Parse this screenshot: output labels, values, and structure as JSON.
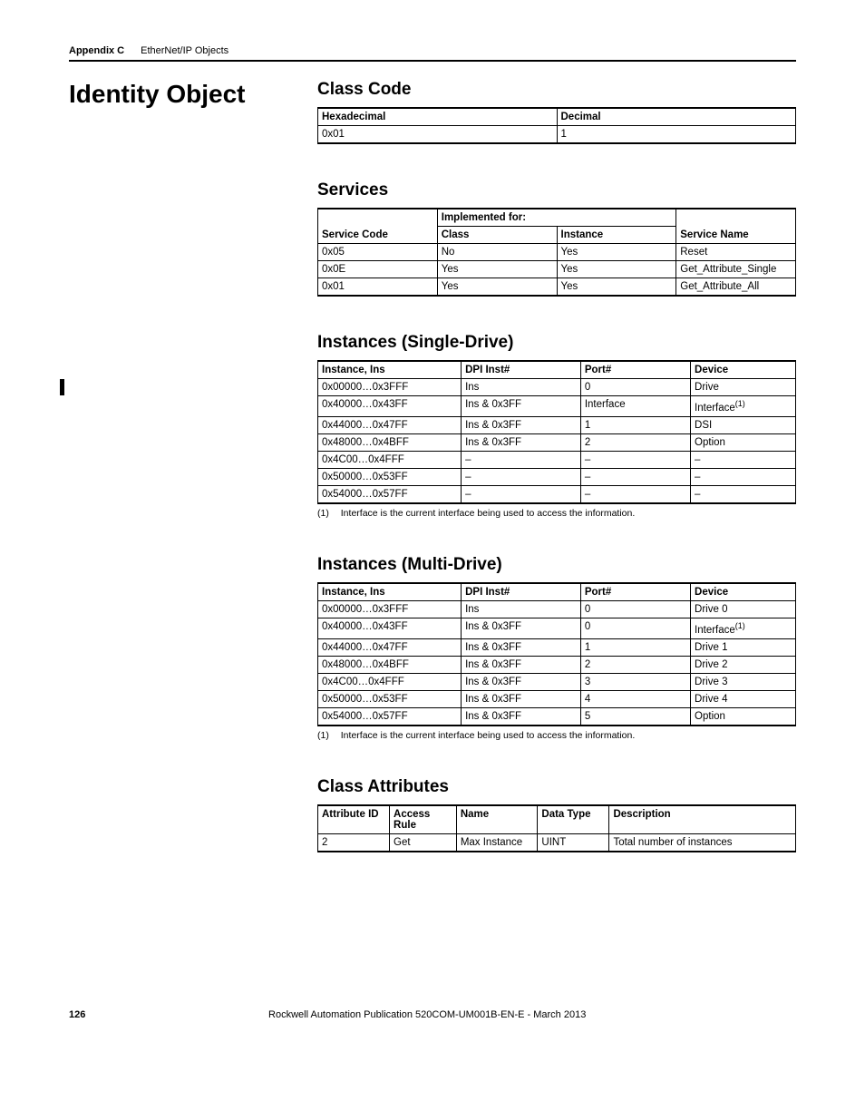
{
  "header": {
    "appendix": "Appendix C",
    "title": "EtherNet/IP Objects"
  },
  "mainHeading": "Identity Object",
  "sections": {
    "classCode": {
      "heading": "Class Code",
      "headers": [
        "Hexadecimal",
        "Decimal"
      ],
      "rows": [
        [
          "0x01",
          "1"
        ]
      ]
    },
    "services": {
      "heading": "Services",
      "groupHeader": "Implemented for:",
      "headers": [
        "Service Code",
        "Class",
        "Instance",
        "Service Name"
      ],
      "rows": [
        [
          "0x05",
          "No",
          "Yes",
          "Reset"
        ],
        [
          "0x0E",
          "Yes",
          "Yes",
          "Get_Attribute_Single"
        ],
        [
          "0x01",
          "Yes",
          "Yes",
          "Get_Attribute_All"
        ]
      ]
    },
    "instancesSingle": {
      "heading": "Instances (Single-Drive)",
      "headers": [
        "Instance, Ins",
        "DPI Inst#",
        "Port#",
        "Device"
      ],
      "rows": [
        {
          "cells": [
            "0x00000…0x3FFF",
            "Ins",
            "0",
            "Drive"
          ],
          "sup": false
        },
        {
          "cells": [
            "0x40000…0x43FF",
            "Ins & 0x3FF",
            "Interface",
            "Interface"
          ],
          "sup": true
        },
        {
          "cells": [
            "0x44000…0x47FF",
            "Ins & 0x3FF",
            "1",
            "DSI"
          ],
          "sup": false
        },
        {
          "cells": [
            "0x48000…0x4BFF",
            "Ins & 0x3FF",
            "2",
            "Option"
          ],
          "sup": false
        },
        {
          "cells": [
            "0x4C00…0x4FFF",
            "–",
            "–",
            "–"
          ],
          "sup": false
        },
        {
          "cells": [
            "0x50000…0x53FF",
            "–",
            "–",
            "–"
          ],
          "sup": false
        },
        {
          "cells": [
            "0x54000…0x57FF",
            "–",
            "–",
            "–"
          ],
          "sup": false
        }
      ],
      "footnote": {
        "num": "(1)",
        "text": "Interface is the current interface being used to access the information."
      }
    },
    "instancesMulti": {
      "heading": "Instances (Multi-Drive)",
      "headers": [
        "Instance, Ins",
        "DPI Inst#",
        "Port#",
        "Device"
      ],
      "rows": [
        {
          "cells": [
            "0x00000…0x3FFF",
            "Ins",
            "0",
            "Drive 0"
          ],
          "sup": false
        },
        {
          "cells": [
            "0x40000…0x43FF",
            "Ins & 0x3FF",
            "0",
            "Interface"
          ],
          "sup": true
        },
        {
          "cells": [
            "0x44000…0x47FF",
            "Ins & 0x3FF",
            "1",
            "Drive 1"
          ],
          "sup": false
        },
        {
          "cells": [
            "0x48000…0x4BFF",
            "Ins & 0x3FF",
            "2",
            "Drive 2"
          ],
          "sup": false
        },
        {
          "cells": [
            "0x4C00…0x4FFF",
            "Ins & 0x3FF",
            "3",
            "Drive 3"
          ],
          "sup": false
        },
        {
          "cells": [
            "0x50000…0x53FF",
            "Ins & 0x3FF",
            "4",
            "Drive 4"
          ],
          "sup": false
        },
        {
          "cells": [
            "0x54000…0x57FF",
            "Ins & 0x3FF",
            "5",
            "Option"
          ],
          "sup": false
        }
      ],
      "footnote": {
        "num": "(1)",
        "text": "Interface is the current interface being used to access the information."
      }
    },
    "classAttributes": {
      "heading": "Class Attributes",
      "headers": [
        "Attribute ID",
        "Access Rule",
        "Name",
        "Data Type",
        "Description"
      ],
      "rows": [
        [
          "2",
          "Get",
          "Max Instance",
          "UINT",
          "Total number of instances"
        ]
      ]
    }
  },
  "footer": {
    "pageNumber": "126",
    "publication": "Rockwell Automation Publication 520COM-UM001B-EN-E - March 2013"
  }
}
